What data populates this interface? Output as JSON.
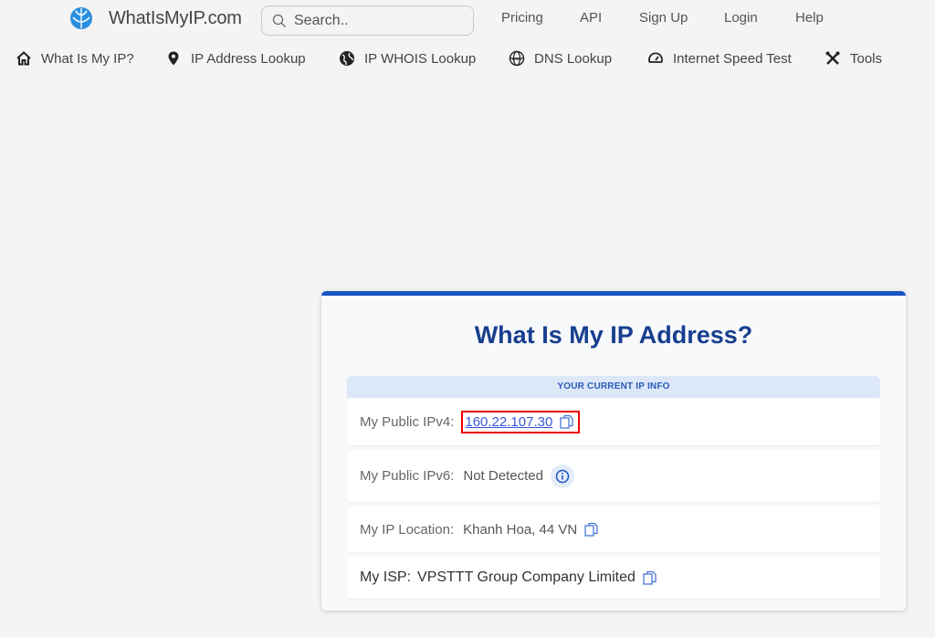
{
  "header": {
    "site_name": "WhatIsMyIP.com",
    "search_placeholder": "Search..",
    "nav": [
      "Pricing",
      "API",
      "Sign Up",
      "Login",
      "Help"
    ]
  },
  "subnav": [
    {
      "label": "What Is My IP?",
      "icon": "home-icon"
    },
    {
      "label": "IP Address Lookup",
      "icon": "map-pin-icon"
    },
    {
      "label": "IP WHOIS Lookup",
      "icon": "globe-icon"
    },
    {
      "label": "DNS Lookup",
      "icon": "dns-globe-icon"
    },
    {
      "label": "Internet Speed Test",
      "icon": "speedometer-icon"
    },
    {
      "label": "Tools",
      "icon": "tools-icon"
    }
  ],
  "card": {
    "title": "What Is My IP Address?",
    "section_header": "YOUR CURRENT IP INFO",
    "ipv4_label": "My Public IPv4:",
    "ipv4_value": "160.22.107.30",
    "ipv6_label": "My Public IPv6:",
    "ipv6_value": "Not Detected",
    "location_label": "My IP Location:",
    "location_value": "Khanh Hoa, 44 VN",
    "isp_label": "My ISP:",
    "isp_value": "VPSTTT Group Company Limited"
  },
  "colors": {
    "accent": "#1a56c4",
    "title": "#173f8f",
    "highlight_box": "#e00000"
  }
}
